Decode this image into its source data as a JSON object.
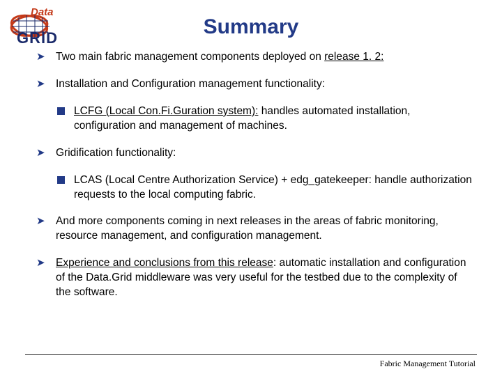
{
  "logo": {
    "top_text": "Data",
    "bottom_text": "GRID"
  },
  "title": "Summary",
  "bullets": {
    "b1_pre": "Two main fabric management components deployed on ",
    "b1_u": "release 1. 2:",
    "b2": "Installation and Configuration management functionality:",
    "b2sub_u": "LCFG (Local Con.Fi.Guration system):",
    "b2sub_rest": " handles automated installation, configuration and management of machines.",
    "b3": "Gridification functionality:",
    "b3sub": "LCAS (Local Centre Authorization Service) + edg_gatekeeper: handle authorization requests to the local computing fabric.",
    "b4": "And more components coming in next releases in the areas of fabric monitoring, resource management, and configuration management.",
    "b5_u": "Experience and conclusions from this release",
    "b5_rest": ": automatic installation and configuration of the Data.Grid middleware was very useful for the testbed due to the complexity of the software."
  },
  "footer": "Fabric Management Tutorial"
}
